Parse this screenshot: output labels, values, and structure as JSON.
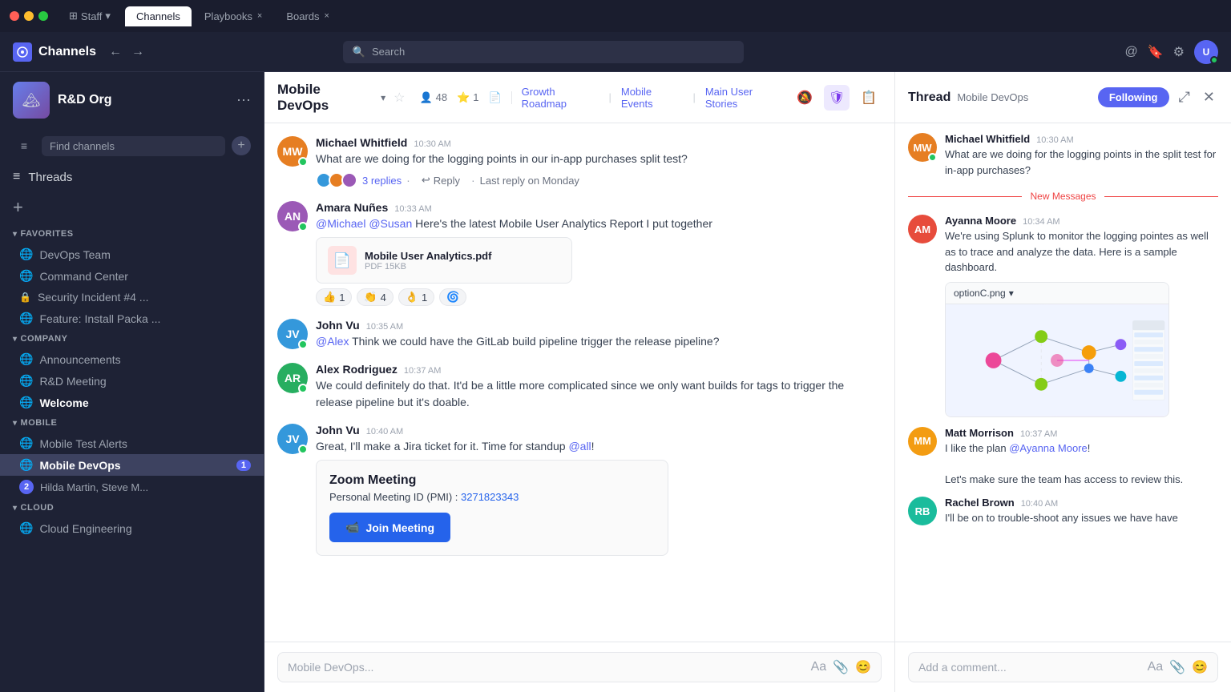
{
  "titlebar": {
    "tabs": [
      {
        "label": "Staff",
        "type": "workspace",
        "active": false
      },
      {
        "label": "Channels",
        "active": true
      },
      {
        "label": "Playbooks",
        "active": false,
        "closeable": true
      },
      {
        "label": "Boards",
        "active": false,
        "closeable": true
      }
    ]
  },
  "topnav": {
    "logo_label": "Channels",
    "search_placeholder": "Search"
  },
  "sidebar": {
    "workspace_name": "R&D Org",
    "find_channels_placeholder": "Find channels",
    "threads_label": "Threads",
    "sections": [
      {
        "name": "FAVORITES",
        "items": [
          {
            "label": "DevOps Team",
            "icon": "globe",
            "type": "channel"
          },
          {
            "label": "Command Center",
            "icon": "globe",
            "type": "channel"
          },
          {
            "label": "Security Incident #4 ...",
            "icon": "lock",
            "type": "channel"
          },
          {
            "label": "Feature: Install Packa ...",
            "icon": "globe",
            "type": "channel"
          }
        ]
      },
      {
        "name": "COMPANY",
        "items": [
          {
            "label": "Announcements",
            "icon": "globe",
            "type": "channel"
          },
          {
            "label": "R&D Meeting",
            "icon": "globe",
            "type": "channel"
          },
          {
            "label": "Welcome",
            "icon": "globe",
            "type": "channel",
            "bold": true
          }
        ]
      },
      {
        "name": "MOBILE",
        "items": [
          {
            "label": "Mobile Test Alerts",
            "icon": "globe",
            "type": "channel"
          },
          {
            "label": "Mobile DevOps",
            "icon": "globe",
            "type": "channel",
            "active": true,
            "badge": "1"
          },
          {
            "label": "Hilda Martin, Steve M...",
            "icon": "dm",
            "type": "dm",
            "dm_badge": "2"
          }
        ]
      },
      {
        "name": "CLOUD",
        "items": [
          {
            "label": "Cloud Engineering",
            "icon": "globe",
            "type": "channel"
          }
        ]
      }
    ]
  },
  "chat": {
    "channel_name": "Mobile DevOps",
    "header_stats": {
      "members": "48",
      "reactions": "1"
    },
    "header_links": [
      {
        "label": "Growth Roadmap"
      },
      {
        "label": "Mobile Events"
      },
      {
        "label": "Main User Stories"
      }
    ],
    "messages": [
      {
        "id": "msg1",
        "author": "MW",
        "author_name": "Michael Whitfield",
        "time": "10:30 AM",
        "text": "What are we doing for the logging points in our in-app purchases split test?",
        "avatar_color": "avatar-color-1",
        "has_status": true,
        "replies": {
          "count": "3 replies",
          "reply_label": "Reply",
          "last_reply": "Last reply on Monday"
        }
      },
      {
        "id": "msg2",
        "author": "AN",
        "author_name": "Amara Nuñes",
        "time": "10:33 AM",
        "text": "@Michael @Susan Here's the latest Mobile User Analytics Report I put together",
        "avatar_color": "avatar-color-2",
        "has_status": true,
        "file": {
          "name": "Mobile User Analytics.pdf",
          "size": "PDF 15KB"
        },
        "reactions": [
          {
            "emoji": "👍",
            "count": "1"
          },
          {
            "emoji": "👏",
            "count": "4"
          },
          {
            "emoji": "👌",
            "count": "1"
          },
          {
            "emoji": "🌀",
            "count": null
          }
        ]
      },
      {
        "id": "msg3",
        "author": "JV",
        "author_name": "John Vu",
        "time": "10:35 AM",
        "text": "@Alex Think we could have the GitLab build pipeline trigger the release pipeline?",
        "avatar_color": "avatar-color-3",
        "has_status": true
      },
      {
        "id": "msg4",
        "author": "AR",
        "author_name": "Alex Rodriguez",
        "time": "10:37 AM",
        "text": "We could definitely do that. It'd be a little more complicated since we only want builds for tags to trigger the release pipeline but it's doable.",
        "avatar_color": "avatar-color-4",
        "has_status": true
      },
      {
        "id": "msg5",
        "author": "JV",
        "author_name": "John Vu",
        "time": "10:40 AM",
        "text": "Great, I'll make a Jira ticket for it. Time for standup @all!",
        "avatar_color": "avatar-color-3",
        "has_status": true,
        "zoom_card": {
          "title": "Zoom Meeting",
          "pmi_label": "Personal Meeting ID (PMI) :",
          "pmi_value": "3271823343",
          "join_label": "Join Meeting"
        }
      }
    ],
    "input_placeholder": "Mobile DevOps..."
  },
  "thread": {
    "title": "Thread",
    "channel_label": "Mobile DevOps",
    "following_label": "Following",
    "messages": [
      {
        "id": "tmsg1",
        "author": "MW",
        "author_name": "Michael Whitfield",
        "time": "10:30 AM",
        "text": "What are we doing for the logging points in the split test for in-app purchases?",
        "avatar_color": "avatar-color-1",
        "has_status": true
      },
      {
        "id": "tmsg2",
        "new_messages_above": true,
        "author": "AM",
        "author_name": "Ayanna Moore",
        "time": "10:34 AM",
        "text": "We're using Splunk to monitor the logging pointes as well as to trace and analyze the data. Here is a sample dashboard.",
        "avatar_color": "avatar-color-5",
        "has_image": true,
        "image_label": "optionC.png"
      },
      {
        "id": "tmsg3",
        "author": "MM",
        "author_name": "Matt Morrison",
        "time": "10:37 AM",
        "text": "I like the plan @Ayanna Moore!\n\nLet's make sure the team has access to review this.",
        "avatar_color": "avatar-color-6",
        "mention": "@Ayanna Moore"
      },
      {
        "id": "tmsg4",
        "author": "RB",
        "author_name": "Rachel Brown",
        "time": "10:40 AM",
        "text": "I'll be on to trouble-shoot any issues we have have",
        "avatar_color": "avatar-color-7"
      }
    ],
    "new_messages_label": "New Messages",
    "comment_placeholder": "Add a comment..."
  }
}
